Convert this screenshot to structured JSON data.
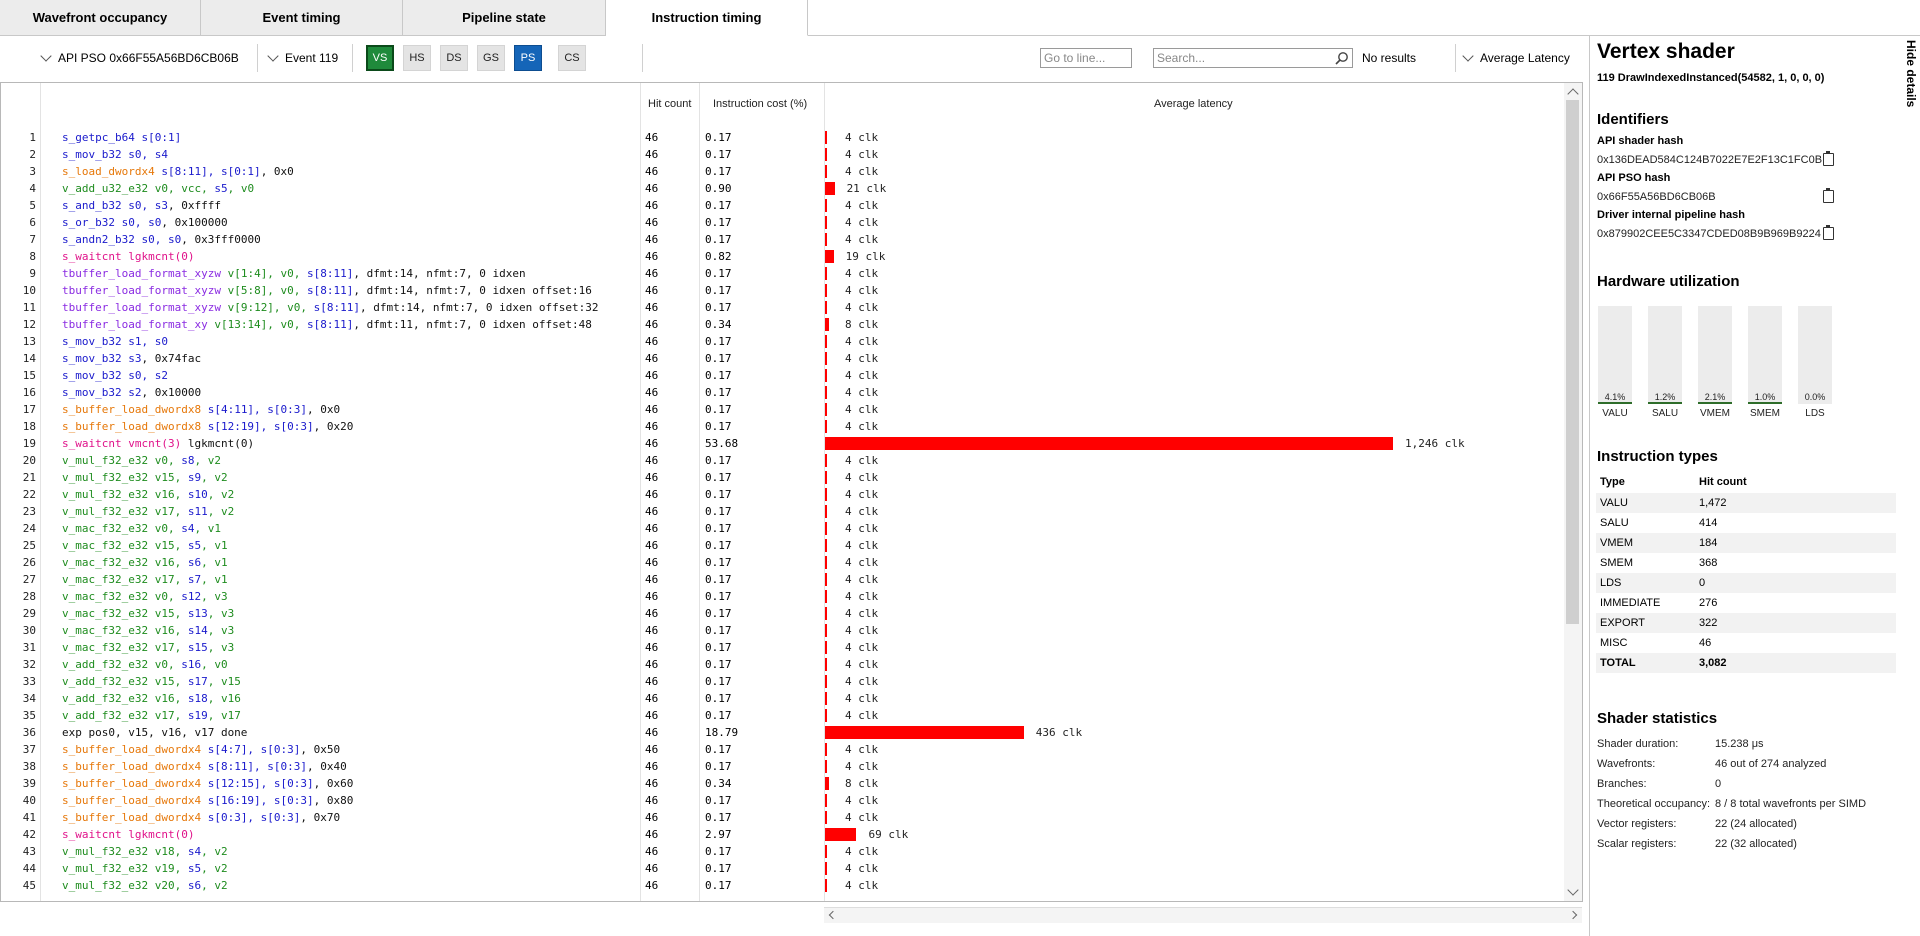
{
  "tabs": [
    "Wavefront occupancy",
    "Event timing",
    "Pipeline state",
    "Instruction timing"
  ],
  "toolbar": {
    "pso_label": "API PSO 0x66F55A56BD6CB06B",
    "event_label": "Event 119",
    "stages": [
      "VS",
      "HS",
      "DS",
      "GS",
      "PS",
      "CS"
    ],
    "goto_placeholder": "Go to line...",
    "search_placeholder": "Search...",
    "search_status": "No results",
    "metric_label": "Average Latency"
  },
  "columns": {
    "hit_count": "Hit count",
    "instruction_cost": "Instruction cost (%)",
    "average_latency": "Average latency"
  },
  "rows": [
    {
      "line": "1",
      "tokens": [
        [
          "s_getpc_b64",
          "s"
        ],
        [
          " s[0:1]",
          "s"
        ]
      ],
      "hits": "46",
      "cost": "0.17",
      "latency": "4 clk",
      "clk": 4
    },
    {
      "line": "2",
      "tokens": [
        [
          "s_mov_b32",
          "s"
        ],
        [
          " s0, s4",
          "s"
        ]
      ],
      "hits": "46",
      "cost": "0.17",
      "latency": "4 clk",
      "clk": 4
    },
    {
      "line": "3",
      "tokens": [
        [
          "s_load_dwordx4",
          "l"
        ],
        [
          " s[8:11], s[0:1]",
          "s"
        ],
        [
          ", 0x0",
          "x"
        ]
      ],
      "hits": "46",
      "cost": "0.17",
      "latency": "4 clk",
      "clk": 4
    },
    {
      "line": "4",
      "tokens": [
        [
          "v_add_u32_e32 v0, vcc, ",
          "v"
        ],
        [
          "s5",
          "s"
        ],
        [
          ", v0",
          "v"
        ]
      ],
      "hits": "46",
      "cost": "0.90",
      "latency": "21 clk",
      "clk": 21
    },
    {
      "line": "5",
      "tokens": [
        [
          "s_and_b32 s0, s3",
          "s"
        ],
        [
          ", 0xffff",
          "x"
        ]
      ],
      "hits": "46",
      "cost": "0.17",
      "latency": "4 clk",
      "clk": 4
    },
    {
      "line": "6",
      "tokens": [
        [
          "s_or_b32 s0, s0",
          "s"
        ],
        [
          ", 0x100000",
          "x"
        ]
      ],
      "hits": "46",
      "cost": "0.17",
      "latency": "4 clk",
      "clk": 4
    },
    {
      "line": "7",
      "tokens": [
        [
          "s_andn2_b32 s0, s0",
          "s"
        ],
        [
          ", 0x3fff0000",
          "x"
        ]
      ],
      "hits": "46",
      "cost": "0.17",
      "latency": "4 clk",
      "clk": 4
    },
    {
      "line": "8",
      "tokens": [
        [
          "s_waitcnt lgkmcnt(0)",
          "w"
        ]
      ],
      "hits": "46",
      "cost": "0.82",
      "latency": "19 clk",
      "clk": 19
    },
    {
      "line": "9",
      "tokens": [
        [
          "tbuffer_load_format_xyzw",
          "m"
        ],
        [
          " v[1:4], v0, ",
          "v"
        ],
        [
          "s[8:11]",
          "s"
        ],
        [
          ", dfmt:14, nfmt:7, 0 idxen",
          "x"
        ]
      ],
      "hits": "46",
      "cost": "0.17",
      "latency": "4 clk",
      "clk": 4
    },
    {
      "line": "10",
      "tokens": [
        [
          "tbuffer_load_format_xyzw",
          "m"
        ],
        [
          " v[5:8], v0, ",
          "v"
        ],
        [
          "s[8:11]",
          "s"
        ],
        [
          ", dfmt:14, nfmt:7, 0 idxen offset:16",
          "x"
        ]
      ],
      "hits": "46",
      "cost": "0.17",
      "latency": "4 clk",
      "clk": 4
    },
    {
      "line": "11",
      "tokens": [
        [
          "tbuffer_load_format_xyzw",
          "m"
        ],
        [
          " v[9:12], v0, ",
          "v"
        ],
        [
          "s[8:11]",
          "s"
        ],
        [
          ", dfmt:14, nfmt:7, 0 idxen offset:32",
          "x"
        ]
      ],
      "hits": "46",
      "cost": "0.17",
      "latency": "4 clk",
      "clk": 4
    },
    {
      "line": "12",
      "tokens": [
        [
          "tbuffer_load_format_xy",
          "m"
        ],
        [
          " v[13:14], v0, ",
          "v"
        ],
        [
          "s[8:11]",
          "s"
        ],
        [
          ", dfmt:11, nfmt:7, 0 idxen offset:48",
          "x"
        ]
      ],
      "hits": "46",
      "cost": "0.34",
      "latency": "8 clk",
      "clk": 8
    },
    {
      "line": "13",
      "tokens": [
        [
          "s_mov_b32 s1, s0",
          "s"
        ]
      ],
      "hits": "46",
      "cost": "0.17",
      "latency": "4 clk",
      "clk": 4
    },
    {
      "line": "14",
      "tokens": [
        [
          "s_mov_b32 s3",
          "s"
        ],
        [
          ", 0x74fac",
          "x"
        ]
      ],
      "hits": "46",
      "cost": "0.17",
      "latency": "4 clk",
      "clk": 4
    },
    {
      "line": "15",
      "tokens": [
        [
          "s_mov_b32 s0, s2",
          "s"
        ]
      ],
      "hits": "46",
      "cost": "0.17",
      "latency": "4 clk",
      "clk": 4
    },
    {
      "line": "16",
      "tokens": [
        [
          "s_mov_b32 s2",
          "s"
        ],
        [
          ", 0x10000",
          "x"
        ]
      ],
      "hits": "46",
      "cost": "0.17",
      "latency": "4 clk",
      "clk": 4
    },
    {
      "line": "17",
      "tokens": [
        [
          "s_buffer_load_dwordx8",
          "l"
        ],
        [
          " s[4:11], s[0:3]",
          "s"
        ],
        [
          ", 0x0",
          "x"
        ]
      ],
      "hits": "46",
      "cost": "0.17",
      "latency": "4 clk",
      "clk": 4
    },
    {
      "line": "18",
      "tokens": [
        [
          "s_buffer_load_dwordx8",
          "l"
        ],
        [
          " s[12:19], s[0:3]",
          "s"
        ],
        [
          ", 0x20",
          "x"
        ]
      ],
      "hits": "46",
      "cost": "0.17",
      "latency": "4 clk",
      "clk": 4
    },
    {
      "line": "19",
      "tokens": [
        [
          "s_waitcnt vmcnt(3)",
          "w"
        ],
        [
          " lgkmcnt(0)",
          "x"
        ]
      ],
      "hits": "46",
      "cost": "53.68",
      "latency": "1,246 clk",
      "clk": 1246
    },
    {
      "line": "20",
      "tokens": [
        [
          "v_mul_f32_e32 v0, ",
          "v"
        ],
        [
          "s8",
          "s"
        ],
        [
          ", v2",
          "v"
        ]
      ],
      "hits": "46",
      "cost": "0.17",
      "latency": "4 clk",
      "clk": 4
    },
    {
      "line": "21",
      "tokens": [
        [
          "v_mul_f32_e32 v15, ",
          "v"
        ],
        [
          "s9",
          "s"
        ],
        [
          ", v2",
          "v"
        ]
      ],
      "hits": "46",
      "cost": "0.17",
      "latency": "4 clk",
      "clk": 4
    },
    {
      "line": "22",
      "tokens": [
        [
          "v_mul_f32_e32 v16, ",
          "v"
        ],
        [
          "s10",
          "s"
        ],
        [
          ", v2",
          "v"
        ]
      ],
      "hits": "46",
      "cost": "0.17",
      "latency": "4 clk",
      "clk": 4
    },
    {
      "line": "23",
      "tokens": [
        [
          "v_mul_f32_e32 v17, ",
          "v"
        ],
        [
          "s11",
          "s"
        ],
        [
          ", v2",
          "v"
        ]
      ],
      "hits": "46",
      "cost": "0.17",
      "latency": "4 clk",
      "clk": 4
    },
    {
      "line": "24",
      "tokens": [
        [
          "v_mac_f32_e32 v0, ",
          "v"
        ],
        [
          "s4",
          "s"
        ],
        [
          ", v1",
          "v"
        ]
      ],
      "hits": "46",
      "cost": "0.17",
      "latency": "4 clk",
      "clk": 4
    },
    {
      "line": "25",
      "tokens": [
        [
          "v_mac_f32_e32 v15, ",
          "v"
        ],
        [
          "s5",
          "s"
        ],
        [
          ", v1",
          "v"
        ]
      ],
      "hits": "46",
      "cost": "0.17",
      "latency": "4 clk",
      "clk": 4
    },
    {
      "line": "26",
      "tokens": [
        [
          "v_mac_f32_e32 v16, ",
          "v"
        ],
        [
          "s6",
          "s"
        ],
        [
          ", v1",
          "v"
        ]
      ],
      "hits": "46",
      "cost": "0.17",
      "latency": "4 clk",
      "clk": 4
    },
    {
      "line": "27",
      "tokens": [
        [
          "v_mac_f32_e32 v17, ",
          "v"
        ],
        [
          "s7",
          "s"
        ],
        [
          ", v1",
          "v"
        ]
      ],
      "hits": "46",
      "cost": "0.17",
      "latency": "4 clk",
      "clk": 4
    },
    {
      "line": "28",
      "tokens": [
        [
          "v_mac_f32_e32 v0, ",
          "v"
        ],
        [
          "s12",
          "s"
        ],
        [
          ", v3",
          "v"
        ]
      ],
      "hits": "46",
      "cost": "0.17",
      "latency": "4 clk",
      "clk": 4
    },
    {
      "line": "29",
      "tokens": [
        [
          "v_mac_f32_e32 v15, ",
          "v"
        ],
        [
          "s13",
          "s"
        ],
        [
          ", v3",
          "v"
        ]
      ],
      "hits": "46",
      "cost": "0.17",
      "latency": "4 clk",
      "clk": 4
    },
    {
      "line": "30",
      "tokens": [
        [
          "v_mac_f32_e32 v16, ",
          "v"
        ],
        [
          "s14",
          "s"
        ],
        [
          ", v3",
          "v"
        ]
      ],
      "hits": "46",
      "cost": "0.17",
      "latency": "4 clk",
      "clk": 4
    },
    {
      "line": "31",
      "tokens": [
        [
          "v_mac_f32_e32 v17, ",
          "v"
        ],
        [
          "s15",
          "s"
        ],
        [
          ", v3",
          "v"
        ]
      ],
      "hits": "46",
      "cost": "0.17",
      "latency": "4 clk",
      "clk": 4
    },
    {
      "line": "32",
      "tokens": [
        [
          "v_add_f32_e32 v0, ",
          "v"
        ],
        [
          "s16",
          "s"
        ],
        [
          ", v0",
          "v"
        ]
      ],
      "hits": "46",
      "cost": "0.17",
      "latency": "4 clk",
      "clk": 4
    },
    {
      "line": "33",
      "tokens": [
        [
          "v_add_f32_e32 v15, ",
          "v"
        ],
        [
          "s17",
          "s"
        ],
        [
          ", v15",
          "v"
        ]
      ],
      "hits": "46",
      "cost": "0.17",
      "latency": "4 clk",
      "clk": 4
    },
    {
      "line": "34",
      "tokens": [
        [
          "v_add_f32_e32 v16, ",
          "v"
        ],
        [
          "s18",
          "s"
        ],
        [
          ", v16",
          "v"
        ]
      ],
      "hits": "46",
      "cost": "0.17",
      "latency": "4 clk",
      "clk": 4
    },
    {
      "line": "35",
      "tokens": [
        [
          "v_add_f32_e32 v17, ",
          "v"
        ],
        [
          "s19",
          "s"
        ],
        [
          ", v17",
          "v"
        ]
      ],
      "hits": "46",
      "cost": "0.17",
      "latency": "4 clk",
      "clk": 4
    },
    {
      "line": "36",
      "tokens": [
        [
          "exp pos0, v15, v16, v17 done",
          "x"
        ]
      ],
      "hits": "46",
      "cost": "18.79",
      "latency": "436 clk",
      "clk": 436
    },
    {
      "line": "37",
      "tokens": [
        [
          "s_buffer_load_dwordx4",
          "l"
        ],
        [
          " s[4:7], s[0:3]",
          "s"
        ],
        [
          ", 0x50",
          "x"
        ]
      ],
      "hits": "46",
      "cost": "0.17",
      "latency": "4 clk",
      "clk": 4
    },
    {
      "line": "38",
      "tokens": [
        [
          "s_buffer_load_dwordx4",
          "l"
        ],
        [
          " s[8:11], s[0:3]",
          "s"
        ],
        [
          ", 0x40",
          "x"
        ]
      ],
      "hits": "46",
      "cost": "0.17",
      "latency": "4 clk",
      "clk": 4
    },
    {
      "line": "39",
      "tokens": [
        [
          "s_buffer_load_dwordx4",
          "l"
        ],
        [
          " s[12:15], s[0:3]",
          "s"
        ],
        [
          ", 0x60",
          "x"
        ]
      ],
      "hits": "46",
      "cost": "0.34",
      "latency": "8 clk",
      "clk": 8
    },
    {
      "line": "40",
      "tokens": [
        [
          "s_buffer_load_dwordx4",
          "l"
        ],
        [
          " s[16:19], s[0:3]",
          "s"
        ],
        [
          ", 0x80",
          "x"
        ]
      ],
      "hits": "46",
      "cost": "0.17",
      "latency": "4 clk",
      "clk": 4
    },
    {
      "line": "41",
      "tokens": [
        [
          "s_buffer_load_dwordx4",
          "l"
        ],
        [
          " s[0:3], s[0:3]",
          "s"
        ],
        [
          ", 0x70",
          "x"
        ]
      ],
      "hits": "46",
      "cost": "0.17",
      "latency": "4 clk",
      "clk": 4
    },
    {
      "line": "42",
      "tokens": [
        [
          "s_waitcnt lgkmcnt(0)",
          "w"
        ]
      ],
      "hits": "46",
      "cost": "2.97",
      "latency": "69 clk",
      "clk": 69
    },
    {
      "line": "43",
      "tokens": [
        [
          "v_mul_f32_e32 v18, ",
          "v"
        ],
        [
          "s4",
          "s"
        ],
        [
          ", v2",
          "v"
        ]
      ],
      "hits": "46",
      "cost": "0.17",
      "latency": "4 clk",
      "clk": 4
    },
    {
      "line": "44",
      "tokens": [
        [
          "v_mul_f32_e32 v19, ",
          "v"
        ],
        [
          "s5",
          "s"
        ],
        [
          ", v2",
          "v"
        ]
      ],
      "hits": "46",
      "cost": "0.17",
      "latency": "4 clk",
      "clk": 4
    },
    {
      "line": "45",
      "tokens": [
        [
          "v_mul_f32_e32 v20, ",
          "v"
        ],
        [
          "s6",
          "s"
        ],
        [
          ", v2",
          "v"
        ]
      ],
      "hits": "46",
      "cost": "0.17",
      "latency": "4 clk",
      "clk": 4
    }
  ],
  "details": {
    "title": "Vertex shader",
    "subtitle": "119 DrawIndexedInstanced(54582, 1, 0, 0, 0)",
    "hide_label": "Hide details",
    "identifiers_heading": "Identifiers",
    "api_shader_hash_label": "API shader hash",
    "api_shader_hash": "0x136DEAD584C124B7022E7E2F13C1FC0B",
    "api_pso_hash_label": "API PSO hash",
    "api_pso_hash": "0x66F55A56BD6CB06B",
    "driver_hash_label": "Driver internal pipeline hash",
    "driver_hash": "0x879902CEE5C3347CDED08B9B969B9224",
    "hw_heading": "Hardware utilization",
    "hw": [
      {
        "label": "VALU",
        "value": "4.1%",
        "pct": 4.1
      },
      {
        "label": "SALU",
        "value": "1.2%",
        "pct": 1.2
      },
      {
        "label": "VMEM",
        "value": "2.1%",
        "pct": 2.1
      },
      {
        "label": "SMEM",
        "value": "1.0%",
        "pct": 1.0
      },
      {
        "label": "LDS",
        "value": "0.0%",
        "pct": 0.0
      }
    ],
    "it_heading": "Instruction types",
    "it_col_type": "Type",
    "it_col_hits": "Hit count",
    "it_rows": [
      {
        "type": "VALU",
        "count": "1,472"
      },
      {
        "type": "SALU",
        "count": "414"
      },
      {
        "type": "VMEM",
        "count": "184"
      },
      {
        "type": "SMEM",
        "count": "368"
      },
      {
        "type": "LDS",
        "count": "0"
      },
      {
        "type": "IMMEDIATE",
        "count": "276"
      },
      {
        "type": "EXPORT",
        "count": "322"
      },
      {
        "type": "MISC",
        "count": "46"
      },
      {
        "type": "TOTAL",
        "count": "3,082"
      }
    ],
    "stats_heading": "Shader statistics",
    "stats": [
      {
        "label": "Shader duration:",
        "value": "15.238 μs"
      },
      {
        "label": "Wavefronts:",
        "value": "46 out of 274 analyzed"
      },
      {
        "label": "Branches:",
        "value": "0"
      },
      {
        "label": "Theoretical occupancy:",
        "value": "8 / 8 total wavefronts per SIMD"
      },
      {
        "label": "Vector registers:",
        "value": "22 (24 allocated)"
      },
      {
        "label": "Scalar registers:",
        "value": "22 (32 allocated)"
      }
    ]
  },
  "colors": {
    "bar": "#ff0000",
    "vs_active": "#1f8a3b",
    "ps_active": "#1565b8",
    "hw_fill": "#2e6d2a"
  }
}
